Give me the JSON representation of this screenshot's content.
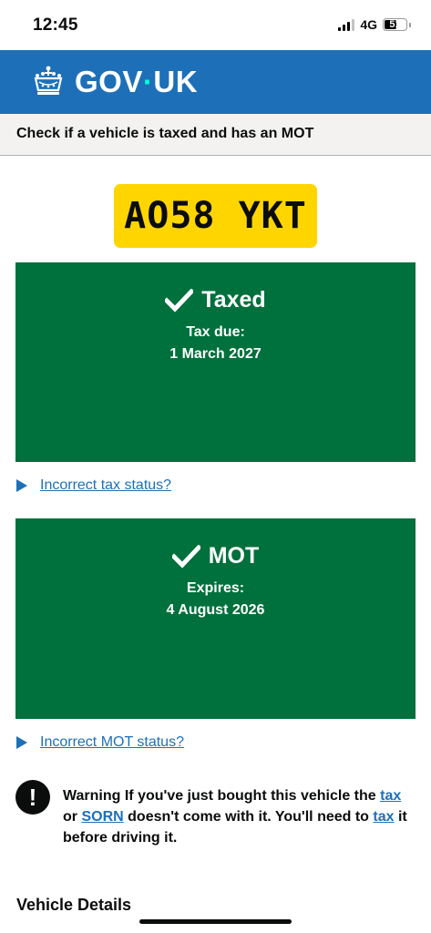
{
  "status_bar": {
    "time": "12:45",
    "network": "4G",
    "battery": "51",
    "battery_level": 0.51
  },
  "header": {
    "logo_text_left": "GOV",
    "logo_dot": "·",
    "logo_text_right": "UK",
    "crown_icon": "crown-icon",
    "brand_color": "#1d70b8"
  },
  "service": {
    "name": "Check if a vehicle is taxed and has an MOT"
  },
  "vehicle": {
    "registration": "AO58 YKT",
    "plate_color": "#ffd500"
  },
  "tax_panel": {
    "title": "Taxed",
    "label": "Tax due:",
    "value": "1 March 2027",
    "icon": "check-icon",
    "color": "#00703c"
  },
  "tax_link": {
    "label": "Incorrect tax status?"
  },
  "mot_panel": {
    "title": "MOT",
    "label": "Expires:",
    "value": "4 August 2026",
    "icon": "check-icon",
    "color": "#00703c"
  },
  "mot_link": {
    "label": "Incorrect MOT status?"
  },
  "warning": {
    "icon_glyph": "!",
    "prefix": "Warning If you've just bought this vehicle the",
    "link_tax": "tax",
    "or": "or",
    "link_sorn": "SORN",
    "middle": "doesn't come with it. You'll need to",
    "link_tax2": "tax",
    "suffix": "it before driving it."
  },
  "vehicle_details": {
    "heading": "Vehicle Details"
  }
}
